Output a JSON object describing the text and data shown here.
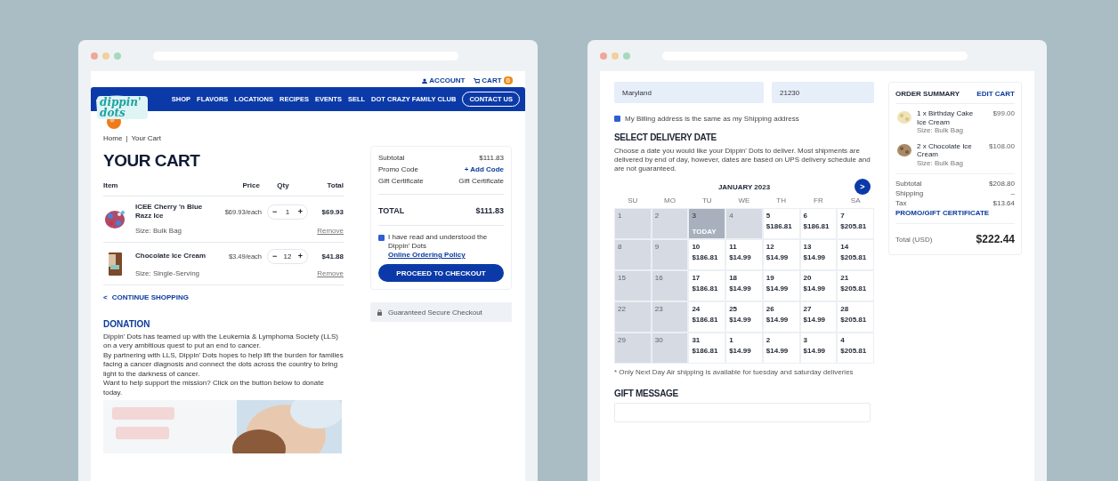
{
  "cart_page": {
    "header": {
      "account": "ACCOUNT",
      "cart": "CART",
      "cart_count": "0",
      "logo": "dippin' dots",
      "nav": [
        "SHOP",
        "FLAVORS",
        "LOCATIONS",
        "RECIPES",
        "EVENTS",
        "SELL",
        "DOT CRAZY FAMILY CLUB"
      ],
      "contact": "CONTACT US"
    },
    "breadcrumb": {
      "items": [
        "Home",
        "Your Cart"
      ],
      "separator": "|"
    },
    "title": "YOUR CART",
    "columns": [
      "Item",
      "Price",
      "Qty",
      "Total"
    ],
    "items": [
      {
        "kind": "bag",
        "name": "ICEE Cherry 'n Blue Razz Ice",
        "price": "$69.93/each",
        "minus": "−",
        "qty": "1",
        "plus": "+",
        "total": "$69.93",
        "size": "Size: Bulk Bag",
        "remove": "Remove"
      },
      {
        "kind": "box",
        "name": "Chocolate Ice Cream",
        "price": "$3.49/each",
        "minus": "−",
        "qty": "12",
        "plus": "+",
        "total": "$41.88",
        "size": "Size: Single-Serving",
        "remove": "Remove"
      }
    ],
    "continue": {
      "arrow": "<",
      "label": "CONTINUE SHOPPING"
    },
    "donation": {
      "title": "DONATION",
      "paragraphs": [
        "Dippin' Dots has teamed up with the Leukemia & Lymphoma Society (LLS) on a very ambitious quest to put an end to cancer.",
        "By partnering with LLS, Dippin' Dots hopes to help lift the burden for families facing a cancer diagnosis and connect the dots across the country to bring light to the darkness of cancer.",
        "Want to help support the mission? Click on the button below to donate today."
      ]
    },
    "summary": {
      "rows": [
        {
          "label": "Subtotal",
          "value": "$111.83",
          "kind": "plain"
        },
        {
          "label": "Promo Code",
          "value": "+ Add Code",
          "kind": "link"
        },
        {
          "label": "Gift Certificate",
          "value": "Gift Certificate",
          "kind": "plain"
        }
      ],
      "total_label": "TOTAL",
      "total": "$111.83",
      "policy": {
        "checked": true,
        "text": "I have read and understood the Dippin' Dots",
        "link": "Online Ordering Policy"
      },
      "button": "PROCEED TO CHECKOUT"
    },
    "secure": "Guaranteed Secure Checkout"
  },
  "checkout_page": {
    "fields": [
      {
        "value": "Maryland"
      },
      {
        "value": "21230"
      }
    ],
    "billing_same": {
      "checked": true,
      "label": "My Billing address is the same as my Shipping address"
    },
    "delivery": {
      "title": "SELECT DELIVERY DATE",
      "text": "Choose a date you would like your Dippin' Dots to deliver. Most shipments are delivered by end of day, however, dates are based on UPS delivery schedule and are not guaranteed.",
      "month": "JANUARY 2023",
      "next": ">",
      "today_label": "TODAY",
      "weekdays": [
        "SU",
        "MO",
        "TU",
        "WE",
        "TH",
        "FR",
        "SA"
      ],
      "weeks": [
        [
          {
            "day": "1",
            "kind": "past"
          },
          {
            "day": "2",
            "kind": "past"
          },
          {
            "day": "3",
            "kind": "today"
          },
          {
            "day": "4",
            "kind": "past"
          },
          {
            "day": "5",
            "kind": "open",
            "price": "$186.81"
          },
          {
            "day": "6",
            "kind": "open",
            "price": "$186.81"
          },
          {
            "day": "7",
            "kind": "open",
            "price": "$205.81"
          }
        ],
        [
          {
            "day": "8",
            "kind": "past"
          },
          {
            "day": "9",
            "kind": "past"
          },
          {
            "day": "10",
            "kind": "open",
            "price": "$186.81"
          },
          {
            "day": "11",
            "kind": "open",
            "price": "$14.99"
          },
          {
            "day": "12",
            "kind": "open",
            "price": "$14.99"
          },
          {
            "day": "13",
            "kind": "open",
            "price": "$14.99"
          },
          {
            "day": "14",
            "kind": "open",
            "price": "$205.81"
          }
        ],
        [
          {
            "day": "15",
            "kind": "past"
          },
          {
            "day": "16",
            "kind": "past"
          },
          {
            "day": "17",
            "kind": "open",
            "price": "$186.81"
          },
          {
            "day": "18",
            "kind": "open",
            "price": "$14.99"
          },
          {
            "day": "19",
            "kind": "open",
            "price": "$14.99"
          },
          {
            "day": "20",
            "kind": "open",
            "price": "$14.99"
          },
          {
            "day": "21",
            "kind": "open",
            "price": "$205.81"
          }
        ],
        [
          {
            "day": "22",
            "kind": "past"
          },
          {
            "day": "23",
            "kind": "past"
          },
          {
            "day": "24",
            "kind": "open",
            "price": "$186.81"
          },
          {
            "day": "25",
            "kind": "open",
            "price": "$14.99"
          },
          {
            "day": "26",
            "kind": "open",
            "price": "$14.99"
          },
          {
            "day": "27",
            "kind": "open",
            "price": "$14.99"
          },
          {
            "day": "28",
            "kind": "open",
            "price": "$205.81"
          }
        ],
        [
          {
            "day": "29",
            "kind": "past"
          },
          {
            "day": "30",
            "kind": "past"
          },
          {
            "day": "31",
            "kind": "open",
            "price": "$186.81"
          },
          {
            "day": "1",
            "kind": "open",
            "price": "$14.99"
          },
          {
            "day": "2",
            "kind": "open",
            "price": "$14.99"
          },
          {
            "day": "3",
            "kind": "open",
            "price": "$14.99"
          },
          {
            "day": "4",
            "kind": "open",
            "price": "$205.81"
          }
        ]
      ],
      "footnote": "* Only Next Day Air shipping is available for tuesday and saturday deliveries"
    },
    "gift_message": {
      "title": "GIFT MESSAGE"
    },
    "order_summary": {
      "title": "ORDER SUMMARY",
      "edit": "EDIT CART",
      "items": [
        {
          "kind": "light",
          "name": "1 x Birthday Cake Ice Cream",
          "size": "Size: Bulk Bag",
          "price": "$99.00"
        },
        {
          "kind": "dark",
          "name": "2 x Chocolate Ice Cream",
          "size": "Size: Bulk Bag",
          "price": "$108.00"
        }
      ],
      "rows": [
        {
          "label": "Subtotal",
          "value": "$208.80"
        },
        {
          "label": "Shipping",
          "value": "–"
        },
        {
          "label": "Tax",
          "value": "$13.64"
        }
      ],
      "promo": "PROMO/GIFT CERTIFICATE",
      "total_label": "Total (USD)",
      "total": "$222.44"
    }
  }
}
